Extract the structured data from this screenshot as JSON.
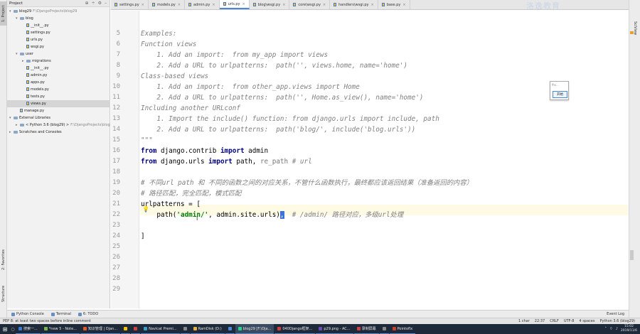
{
  "left_tool_strip": {
    "project": "1: Project",
    "favorites": "2: Favorites",
    "structure": "Structure"
  },
  "project_panel": {
    "header_title": "Project",
    "tree": [
      {
        "label": "blog29",
        "hint": "F:\\DjangoProjects\\blog29",
        "depth": 0,
        "kind": "folder",
        "expanded": true
      },
      {
        "label": "blog",
        "hint": "",
        "depth": 1,
        "kind": "folder",
        "expanded": true
      },
      {
        "label": "__init__.py",
        "hint": "",
        "depth": 2,
        "kind": "file"
      },
      {
        "label": "settings.py",
        "hint": "",
        "depth": 2,
        "kind": "file"
      },
      {
        "label": "urls.py",
        "hint": "",
        "depth": 2,
        "kind": "file"
      },
      {
        "label": "wsgi.py",
        "hint": "",
        "depth": 2,
        "kind": "file"
      },
      {
        "label": "user",
        "hint": "",
        "depth": 1,
        "kind": "folder",
        "expanded": true
      },
      {
        "label": "migrations",
        "hint": "",
        "depth": 2,
        "kind": "folder",
        "expanded": false
      },
      {
        "label": "__init__.py",
        "hint": "",
        "depth": 2,
        "kind": "file"
      },
      {
        "label": "admin.py",
        "hint": "",
        "depth": 2,
        "kind": "file"
      },
      {
        "label": "apps.py",
        "hint": "",
        "depth": 2,
        "kind": "file"
      },
      {
        "label": "models.py",
        "hint": "",
        "depth": 2,
        "kind": "file"
      },
      {
        "label": "tests.py",
        "hint": "",
        "depth": 2,
        "kind": "file"
      },
      {
        "label": "views.py",
        "hint": "",
        "depth": 2,
        "kind": "file",
        "selected": true
      },
      {
        "label": "manage.py",
        "hint": "",
        "depth": 1,
        "kind": "file"
      },
      {
        "label": "External Libraries",
        "hint": "",
        "depth": 0,
        "kind": "folder",
        "expanded": true
      },
      {
        "label": "< Python 3.6 (blog29) >",
        "hint": "F:\\DjangoProjects\\blog29",
        "depth": 1,
        "kind": "folder",
        "expanded": false
      },
      {
        "label": "Scratches and Consoles",
        "hint": "",
        "depth": 0,
        "kind": "folder",
        "expanded": false
      }
    ]
  },
  "editor_tabs": [
    {
      "label": "settings.py",
      "active": false
    },
    {
      "label": "models.py",
      "active": false
    },
    {
      "label": "admin.py",
      "active": false
    },
    {
      "label": "urls.py",
      "active": true
    },
    {
      "label": "blog\\wsgi.py",
      "active": false
    },
    {
      "label": "core\\wsgi.py",
      "active": false
    },
    {
      "label": "handlers\\wsgi.py",
      "active": false
    },
    {
      "label": "base.py",
      "active": false
    }
  ],
  "code_lines": [
    {
      "num": "5",
      "kind": "doc",
      "parts": [
        {
          "t": "Examples:"
        }
      ]
    },
    {
      "num": "6",
      "kind": "doc",
      "parts": [
        {
          "t": "Function views"
        }
      ]
    },
    {
      "num": "7",
      "kind": "doc",
      "parts": [
        {
          "t": "    1. Add an import:  from my_app import views"
        }
      ]
    },
    {
      "num": "8",
      "kind": "doc",
      "parts": [
        {
          "t": "    2. Add a URL to urlpatterns:  path('', views.home, name='home')"
        }
      ]
    },
    {
      "num": "9",
      "kind": "doc",
      "parts": [
        {
          "t": "Class-based views"
        }
      ]
    },
    {
      "num": "10",
      "kind": "doc",
      "parts": [
        {
          "t": "    1. Add an import:  from other_app.views import Home"
        }
      ]
    },
    {
      "num": "11",
      "kind": "doc",
      "parts": [
        {
          "t": "    2. Add a URL to urlpatterns:  path('', Home.as_view(), name='home')"
        }
      ]
    },
    {
      "num": "12",
      "kind": "doc",
      "parts": [
        {
          "t": "Including another URLconf"
        }
      ]
    },
    {
      "num": "13",
      "kind": "doc",
      "parts": [
        {
          "t": "    1. Import the include() function: from django.urls import include, path"
        }
      ]
    },
    {
      "num": "14",
      "kind": "doc",
      "parts": [
        {
          "t": "    2. Add a URL to urlpatterns:  path('blog/', include('blog.urls'))"
        }
      ]
    },
    {
      "num": "15",
      "kind": "doc",
      "parts": [
        {
          "t": "\"\"\""
        }
      ]
    },
    {
      "num": "16",
      "kind": "code",
      "parts": [
        {
          "t": "from",
          "c": "kw"
        },
        {
          "t": " django.contrib "
        },
        {
          "t": "import",
          "c": "kw"
        },
        {
          "t": " admin"
        }
      ]
    },
    {
      "num": "17",
      "kind": "code",
      "parts": [
        {
          "t": "from",
          "c": "kw"
        },
        {
          "t": " django.urls "
        },
        {
          "t": "import",
          "c": "kw"
        },
        {
          "t": " path, "
        },
        {
          "t": "re_path ",
          "c": "dim"
        },
        {
          "t": "# url",
          "c": "cmt"
        }
      ]
    },
    {
      "num": "18",
      "kind": "code",
      "parts": [
        {
          "t": ""
        }
      ]
    },
    {
      "num": "19",
      "kind": "cmt",
      "parts": [
        {
          "t": "# 不同url path 和 不同的函数之间的对应关系，不管什么函数执行，最终都应该返回结果（准备返回的内容）"
        }
      ]
    },
    {
      "num": "20",
      "kind": "cmt",
      "parts": [
        {
          "t": "# 路径匹配，完全匹配，模式匹配"
        }
      ]
    },
    {
      "num": "21",
      "kind": "code",
      "parts": [
        {
          "t": "urlpatterns = ["
        }
      ]
    },
    {
      "num": "22",
      "kind": "code",
      "parts": [
        {
          "t": "    path("
        },
        {
          "t": "'admin/'",
          "c": "str"
        },
        {
          "t": ", admin.site.urls)"
        },
        {
          "t": ",",
          "c": "hl"
        },
        {
          "t": "  # /admin/ 路径对应，多级url处理",
          "c": "cmt"
        }
      ]
    },
    {
      "num": "23",
      "kind": "code",
      "parts": [
        {
          "t": ""
        }
      ]
    },
    {
      "num": "24",
      "kind": "code",
      "parts": [
        {
          "t": "]"
        }
      ]
    },
    {
      "num": "25",
      "kind": "code",
      "parts": [
        {
          "t": ""
        }
      ]
    },
    {
      "num": "26",
      "kind": "code",
      "parts": [
        {
          "t": ""
        }
      ]
    },
    {
      "num": "27",
      "kind": "code",
      "parts": [
        {
          "t": ""
        }
      ]
    },
    {
      "num": "28",
      "kind": "code",
      "parts": [
        {
          "t": ""
        }
      ]
    },
    {
      "num": "29",
      "kind": "code",
      "parts": [
        {
          "t": ""
        }
      ]
    }
  ],
  "right_tool_strip": {
    "sciview": "SciView"
  },
  "popup": {
    "label": "fhs...",
    "button": "开始"
  },
  "bottom_tabs": [
    {
      "label": "Python Console"
    },
    {
      "label": "Terminal"
    },
    {
      "label": "6: TODO"
    }
  ],
  "event_log": "Event Log",
  "status_bar": {
    "message": "PEP 8: at least two spaces before inline comment",
    "items": [
      "1 char",
      "22:37",
      "CRLF",
      "UTF-8",
      "4 spaces",
      "Python 3.6 (blog29)"
    ]
  },
  "taskbar": {
    "tasks": [
      {
        "label": "搜索一...",
        "color": "#3a7bd5"
      },
      {
        "label": "*new 5 - Note...",
        "color": "#7ab648"
      },
      {
        "label": "知识管理 | Djan...",
        "color": "#e05a28"
      },
      {
        "label": "",
        "color": "#f2c200"
      },
      {
        "label": "",
        "color": "#d04040"
      },
      {
        "label": "Navicat Premi...",
        "color": "#3aa0c8"
      },
      {
        "label": "",
        "color": "#888888"
      },
      {
        "label": "RamDisk (D:)",
        "color": "#e8b040"
      },
      {
        "label": "",
        "color": "#4a88d8"
      },
      {
        "label": "blog29 [F:\\Dja...",
        "color": "#21d789",
        "active": true
      },
      {
        "label": "040Django框架...",
        "color": "#d04040"
      },
      {
        "label": "p29.png - AC...",
        "color": "#6a4ab5"
      },
      {
        "label": "录制屏幕",
        "color": "#d04040"
      },
      {
        "label": "",
        "color": "#888888"
      },
      {
        "label": "PointofIx",
        "color": "#c84030"
      }
    ],
    "time": "15:02",
    "date": "2019/11/6"
  },
  "watermark": "洛逸教育"
}
